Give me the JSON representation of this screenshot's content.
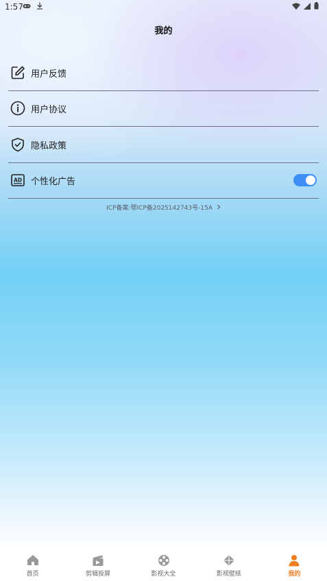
{
  "status_bar": {
    "time": "1:57",
    "left_icons": [
      "gamepad-icon",
      "download-icon"
    ],
    "right_icons": [
      "wifi-icon",
      "signal-icon",
      "battery-icon"
    ]
  },
  "page": {
    "title": "我的"
  },
  "menu": [
    {
      "label": "用户反馈",
      "icon": "edit-icon"
    },
    {
      "label": "用户协议",
      "icon": "info-icon"
    },
    {
      "label": "隐私政策",
      "icon": "shield-icon"
    },
    {
      "label": "个性化广告",
      "icon": "ad-icon",
      "toggle_on": true
    }
  ],
  "icp": {
    "text": "ICP备案:鄂ICP备2025142743号-15A"
  },
  "tabbar": {
    "tabs": [
      {
        "label": "首页",
        "icon": "home-icon"
      },
      {
        "label": "剪辑投屏",
        "icon": "clapper-icon"
      },
      {
        "label": "影视大全",
        "icon": "film-reel-icon"
      },
      {
        "label": "影视壁纸",
        "icon": "diamond-icon"
      },
      {
        "label": "我的",
        "icon": "person-icon",
        "active": true
      }
    ],
    "active_color": "#f07e1e"
  }
}
